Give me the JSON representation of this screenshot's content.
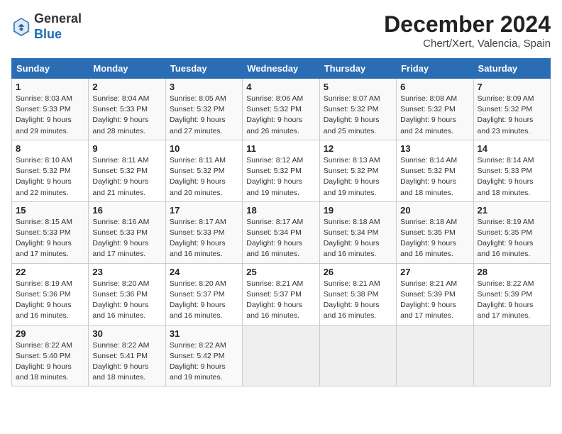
{
  "header": {
    "logo_general": "General",
    "logo_blue": "Blue",
    "title": "December 2024",
    "subtitle": "Chert/Xert, Valencia, Spain"
  },
  "weekdays": [
    "Sunday",
    "Monday",
    "Tuesday",
    "Wednesday",
    "Thursday",
    "Friday",
    "Saturday"
  ],
  "weeks": [
    [
      {
        "day": "1",
        "sunrise": "Sunrise: 8:03 AM",
        "sunset": "Sunset: 5:33 PM",
        "daylight": "Daylight: 9 hours and 29 minutes."
      },
      {
        "day": "2",
        "sunrise": "Sunrise: 8:04 AM",
        "sunset": "Sunset: 5:33 PM",
        "daylight": "Daylight: 9 hours and 28 minutes."
      },
      {
        "day": "3",
        "sunrise": "Sunrise: 8:05 AM",
        "sunset": "Sunset: 5:32 PM",
        "daylight": "Daylight: 9 hours and 27 minutes."
      },
      {
        "day": "4",
        "sunrise": "Sunrise: 8:06 AM",
        "sunset": "Sunset: 5:32 PM",
        "daylight": "Daylight: 9 hours and 26 minutes."
      },
      {
        "day": "5",
        "sunrise": "Sunrise: 8:07 AM",
        "sunset": "Sunset: 5:32 PM",
        "daylight": "Daylight: 9 hours and 25 minutes."
      },
      {
        "day": "6",
        "sunrise": "Sunrise: 8:08 AM",
        "sunset": "Sunset: 5:32 PM",
        "daylight": "Daylight: 9 hours and 24 minutes."
      },
      {
        "day": "7",
        "sunrise": "Sunrise: 8:09 AM",
        "sunset": "Sunset: 5:32 PM",
        "daylight": "Daylight: 9 hours and 23 minutes."
      }
    ],
    [
      {
        "day": "8",
        "sunrise": "Sunrise: 8:10 AM",
        "sunset": "Sunset: 5:32 PM",
        "daylight": "Daylight: 9 hours and 22 minutes."
      },
      {
        "day": "9",
        "sunrise": "Sunrise: 8:11 AM",
        "sunset": "Sunset: 5:32 PM",
        "daylight": "Daylight: 9 hours and 21 minutes."
      },
      {
        "day": "10",
        "sunrise": "Sunrise: 8:11 AM",
        "sunset": "Sunset: 5:32 PM",
        "daylight": "Daylight: 9 hours and 20 minutes."
      },
      {
        "day": "11",
        "sunrise": "Sunrise: 8:12 AM",
        "sunset": "Sunset: 5:32 PM",
        "daylight": "Daylight: 9 hours and 19 minutes."
      },
      {
        "day": "12",
        "sunrise": "Sunrise: 8:13 AM",
        "sunset": "Sunset: 5:32 PM",
        "daylight": "Daylight: 9 hours and 19 minutes."
      },
      {
        "day": "13",
        "sunrise": "Sunrise: 8:14 AM",
        "sunset": "Sunset: 5:32 PM",
        "daylight": "Daylight: 9 hours and 18 minutes."
      },
      {
        "day": "14",
        "sunrise": "Sunrise: 8:14 AM",
        "sunset": "Sunset: 5:33 PM",
        "daylight": "Daylight: 9 hours and 18 minutes."
      }
    ],
    [
      {
        "day": "15",
        "sunrise": "Sunrise: 8:15 AM",
        "sunset": "Sunset: 5:33 PM",
        "daylight": "Daylight: 9 hours and 17 minutes."
      },
      {
        "day": "16",
        "sunrise": "Sunrise: 8:16 AM",
        "sunset": "Sunset: 5:33 PM",
        "daylight": "Daylight: 9 hours and 17 minutes."
      },
      {
        "day": "17",
        "sunrise": "Sunrise: 8:17 AM",
        "sunset": "Sunset: 5:33 PM",
        "daylight": "Daylight: 9 hours and 16 minutes."
      },
      {
        "day": "18",
        "sunrise": "Sunrise: 8:17 AM",
        "sunset": "Sunset: 5:34 PM",
        "daylight": "Daylight: 9 hours and 16 minutes."
      },
      {
        "day": "19",
        "sunrise": "Sunrise: 8:18 AM",
        "sunset": "Sunset: 5:34 PM",
        "daylight": "Daylight: 9 hours and 16 minutes."
      },
      {
        "day": "20",
        "sunrise": "Sunrise: 8:18 AM",
        "sunset": "Sunset: 5:35 PM",
        "daylight": "Daylight: 9 hours and 16 minutes."
      },
      {
        "day": "21",
        "sunrise": "Sunrise: 8:19 AM",
        "sunset": "Sunset: 5:35 PM",
        "daylight": "Daylight: 9 hours and 16 minutes."
      }
    ],
    [
      {
        "day": "22",
        "sunrise": "Sunrise: 8:19 AM",
        "sunset": "Sunset: 5:36 PM",
        "daylight": "Daylight: 9 hours and 16 minutes."
      },
      {
        "day": "23",
        "sunrise": "Sunrise: 8:20 AM",
        "sunset": "Sunset: 5:36 PM",
        "daylight": "Daylight: 9 hours and 16 minutes."
      },
      {
        "day": "24",
        "sunrise": "Sunrise: 8:20 AM",
        "sunset": "Sunset: 5:37 PM",
        "daylight": "Daylight: 9 hours and 16 minutes."
      },
      {
        "day": "25",
        "sunrise": "Sunrise: 8:21 AM",
        "sunset": "Sunset: 5:37 PM",
        "daylight": "Daylight: 9 hours and 16 minutes."
      },
      {
        "day": "26",
        "sunrise": "Sunrise: 8:21 AM",
        "sunset": "Sunset: 5:38 PM",
        "daylight": "Daylight: 9 hours and 16 minutes."
      },
      {
        "day": "27",
        "sunrise": "Sunrise: 8:21 AM",
        "sunset": "Sunset: 5:39 PM",
        "daylight": "Daylight: 9 hours and 17 minutes."
      },
      {
        "day": "28",
        "sunrise": "Sunrise: 8:22 AM",
        "sunset": "Sunset: 5:39 PM",
        "daylight": "Daylight: 9 hours and 17 minutes."
      }
    ],
    [
      {
        "day": "29",
        "sunrise": "Sunrise: 8:22 AM",
        "sunset": "Sunset: 5:40 PM",
        "daylight": "Daylight: 9 hours and 18 minutes."
      },
      {
        "day": "30",
        "sunrise": "Sunrise: 8:22 AM",
        "sunset": "Sunset: 5:41 PM",
        "daylight": "Daylight: 9 hours and 18 minutes."
      },
      {
        "day": "31",
        "sunrise": "Sunrise: 8:22 AM",
        "sunset": "Sunset: 5:42 PM",
        "daylight": "Daylight: 9 hours and 19 minutes."
      },
      null,
      null,
      null,
      null
    ]
  ]
}
